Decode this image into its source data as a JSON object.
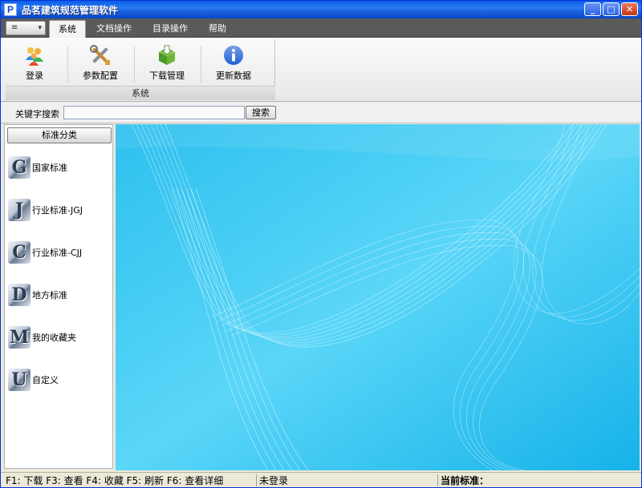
{
  "window": {
    "title": "品茗建筑规范管理软件",
    "app_icon": "P"
  },
  "tabs": [
    {
      "label": "系统",
      "active": true
    },
    {
      "label": "文档操作",
      "active": false
    },
    {
      "label": "目录操作",
      "active": false
    },
    {
      "label": "帮助",
      "active": false
    }
  ],
  "ribbon": {
    "group_label": "系统",
    "buttons": [
      {
        "label": "登录",
        "icon": "users-icon"
      },
      {
        "label": "参数配置",
        "icon": "tools-icon"
      },
      {
        "label": "下载管理",
        "icon": "download-box-icon"
      },
      {
        "label": "更新数据",
        "icon": "info-icon"
      }
    ]
  },
  "search": {
    "label": "关键字搜索",
    "value": "",
    "button_label": "搜索"
  },
  "categories": {
    "header": "标准分类",
    "items": [
      {
        "letter": "G",
        "label": "国家标准"
      },
      {
        "letter": "J",
        "label": "行业标准-JGJ"
      },
      {
        "letter": "C",
        "label": "行业标准-CJJ"
      },
      {
        "letter": "D",
        "label": "地方标准"
      },
      {
        "letter": "M",
        "label": "我的收藏夹"
      },
      {
        "letter": "U",
        "label": "自定义"
      }
    ]
  },
  "statusbar": {
    "keys": "F1: 下载 F3: 查看 F4: 收藏 F5: 刷新 F6: 查看详细",
    "login_status": "未登录",
    "current_standard_label": "当前标准："
  },
  "colors": {
    "titlebar": "#0a5ee8",
    "content_bg": "#2ec2ef",
    "tabbar": "#5a5a5a"
  }
}
